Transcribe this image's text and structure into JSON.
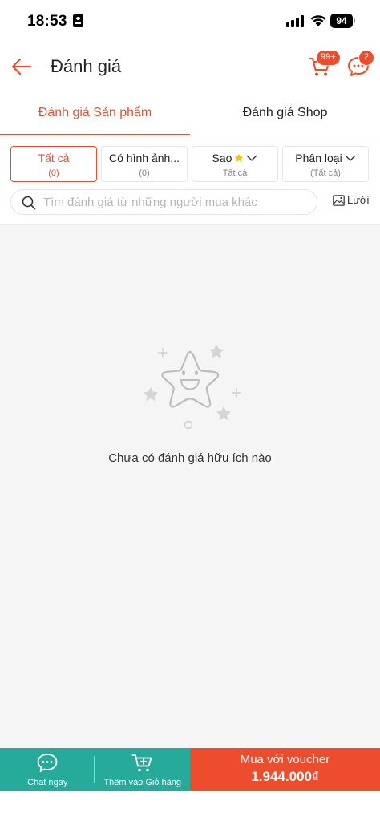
{
  "status": {
    "time": "18:53",
    "battery": "94"
  },
  "header": {
    "title": "Đánh giá",
    "cart_badge": "99+",
    "chat_badge": "2"
  },
  "tabs": [
    {
      "label": "Đánh giá Sản phẩm",
      "active": true
    },
    {
      "label": "Đánh giá Shop",
      "active": false
    }
  ],
  "filters": [
    {
      "label": "Tất cả",
      "sub": "(0)",
      "active": true
    },
    {
      "label": "Có hình ảnh...",
      "sub": "(0)",
      "active": false
    },
    {
      "label": "Sao",
      "sub": "Tất cả",
      "active": false
    },
    {
      "label": "Phân loại",
      "sub": "(Tất cả)",
      "active": false
    }
  ],
  "search": {
    "placeholder": "Tìm đánh giá từ những người mua khác",
    "grid_label": "Lưới"
  },
  "empty": {
    "message": "Chưa có đánh giá hữu ích nào"
  },
  "bottom": {
    "chat_label": "Chat ngay",
    "cart_label": "Thêm vào Giỏ hàng",
    "buy_label": "Mua với voucher",
    "buy_price": "1.944.000₫"
  },
  "colors": {
    "brand": "#ee4d2d",
    "teal": "#26aa99",
    "star": "#ffc107"
  }
}
